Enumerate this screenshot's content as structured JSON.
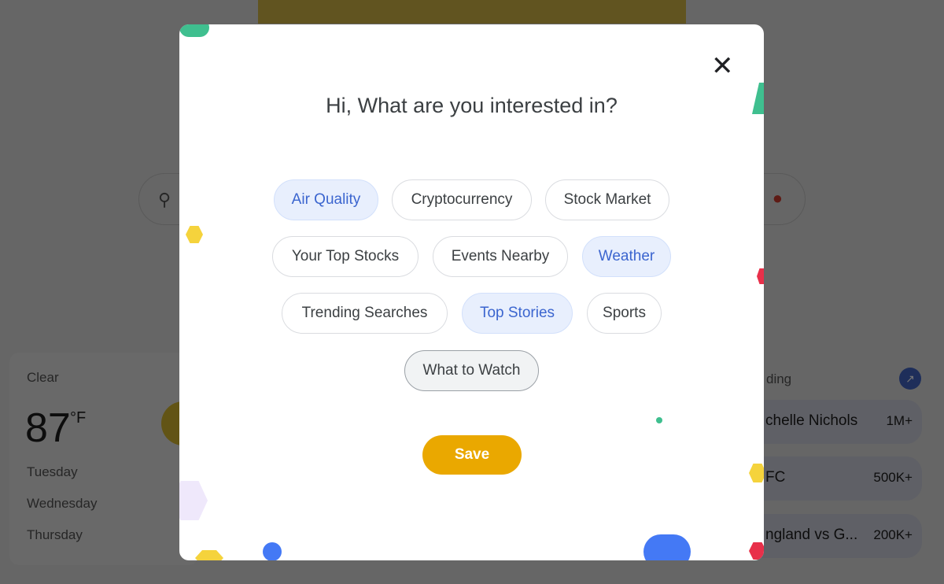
{
  "background": {
    "weather": {
      "condition": "Clear",
      "temperature": "87",
      "unit": "°F",
      "days": [
        "Tuesday",
        "Wednesday",
        "Thursday"
      ]
    },
    "trending": {
      "title": "ding",
      "items": [
        {
          "name": "chelle Nichols",
          "count": "1M+"
        },
        {
          "name": "FC",
          "count": "500K+"
        },
        {
          "name": "ngland vs G...",
          "count": "200K+"
        }
      ]
    }
  },
  "modal": {
    "title": "Hi, What are you interested in?",
    "topics": [
      {
        "label": "Air Quality",
        "selected": true
      },
      {
        "label": "Cryptocurrency",
        "selected": false
      },
      {
        "label": "Stock Market",
        "selected": false
      },
      {
        "label": "Your Top Stocks",
        "selected": false
      },
      {
        "label": "Events Nearby",
        "selected": false
      },
      {
        "label": "Weather",
        "selected": true
      },
      {
        "label": "Trending Searches",
        "selected": false
      },
      {
        "label": "Top Stories",
        "selected": true
      },
      {
        "label": "Sports",
        "selected": false
      },
      {
        "label": "What to Watch",
        "selected": false
      }
    ],
    "save_label": "Save",
    "close_icon": "close-icon"
  },
  "colors": {
    "accent": "#3b65cf",
    "save": "#eaa800",
    "selected_bg": "#e8effd"
  }
}
